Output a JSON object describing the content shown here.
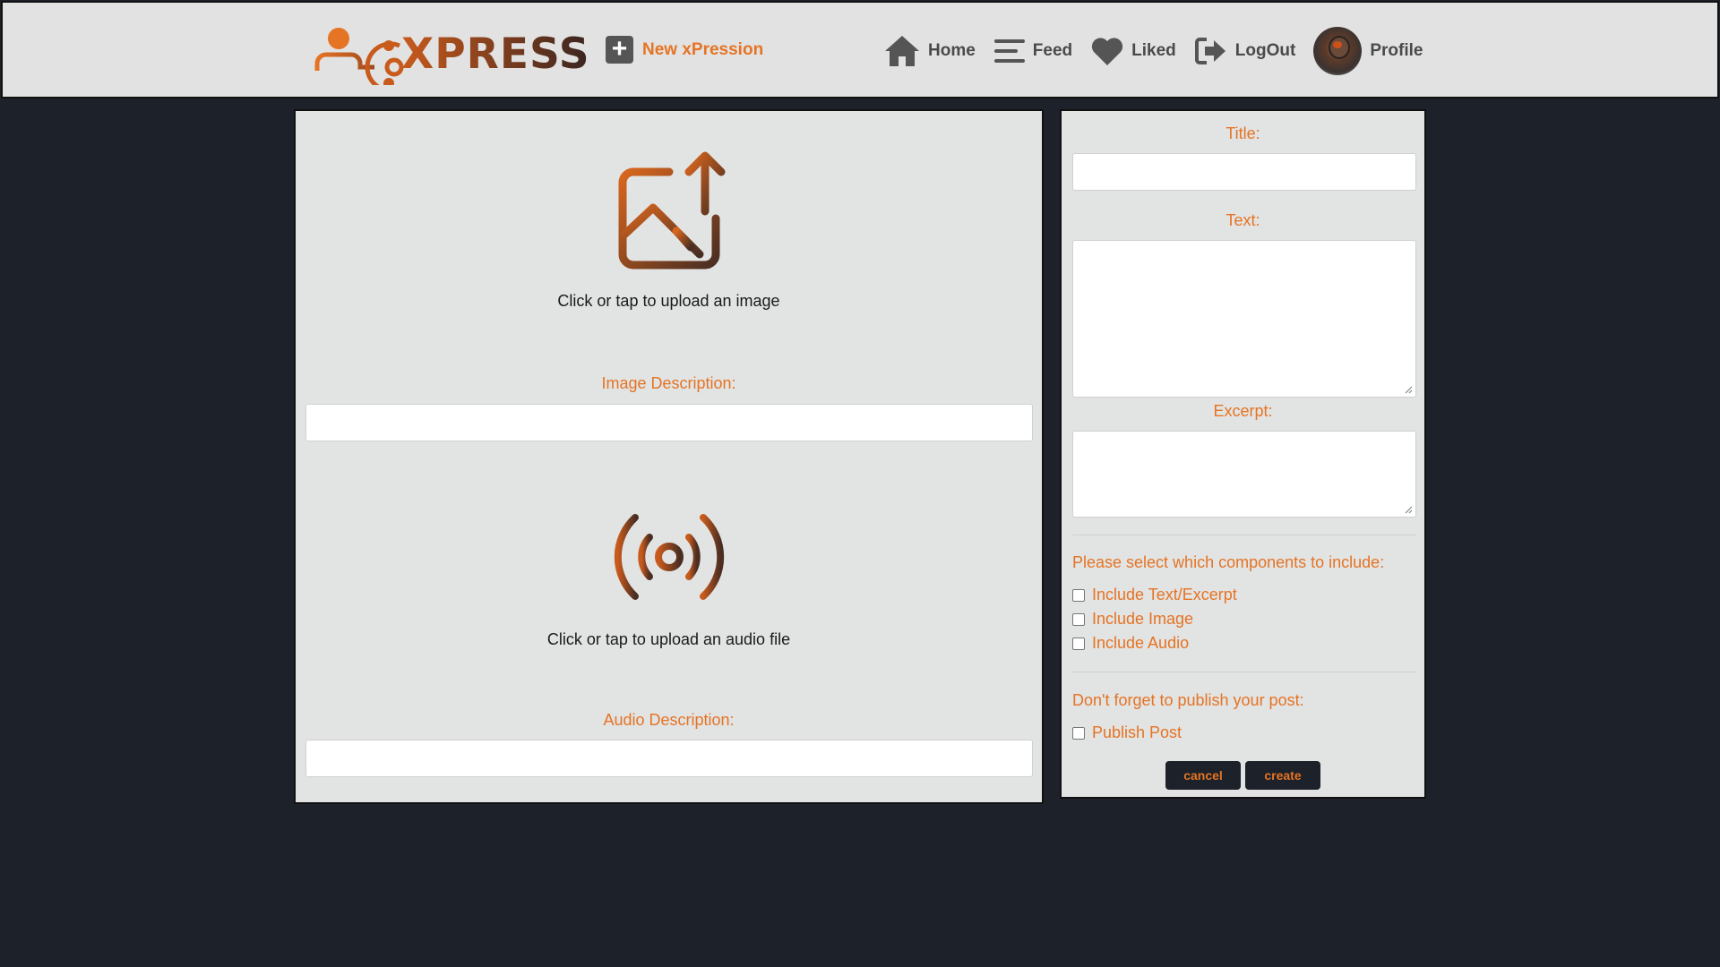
{
  "header": {
    "logo_text": "XPRESS",
    "new_post_label": "New xPression",
    "nav": [
      {
        "label": "Home",
        "icon": "home-icon"
      },
      {
        "label": "Feed",
        "icon": "menu-icon"
      },
      {
        "label": "Liked",
        "icon": "heart-icon"
      },
      {
        "label": "LogOut",
        "icon": "logout-icon"
      }
    ],
    "profile_label": "Profile"
  },
  "media": {
    "image_upload_text": "Click or tap to upload an image",
    "image_description_label": "Image Description:",
    "image_description_value": "",
    "audio_upload_text": "Click or tap to upload an audio file",
    "audio_description_label": "Audio Description:",
    "audio_description_value": ""
  },
  "form": {
    "title_label": "Title:",
    "title_value": "",
    "text_label": "Text:",
    "text_value": "",
    "excerpt_label": "Excerpt:",
    "excerpt_value": "",
    "components_prompt": "Please select which components to include:",
    "components": [
      {
        "label": "Include Text/Excerpt",
        "checked": false
      },
      {
        "label": "Include Image",
        "checked": false
      },
      {
        "label": "Include Audio",
        "checked": false
      }
    ],
    "publish_prompt": "Don't forget to publish your post:",
    "publish_label": "Publish Post",
    "publish_checked": false,
    "cancel_label": "cancel",
    "create_label": "create"
  },
  "colors": {
    "accent": "#e57424",
    "background": "#1d2129",
    "panel": "#e2e3e3",
    "logo_gradient_start": "#c85a1c",
    "logo_gradient_end": "#3a2520"
  }
}
